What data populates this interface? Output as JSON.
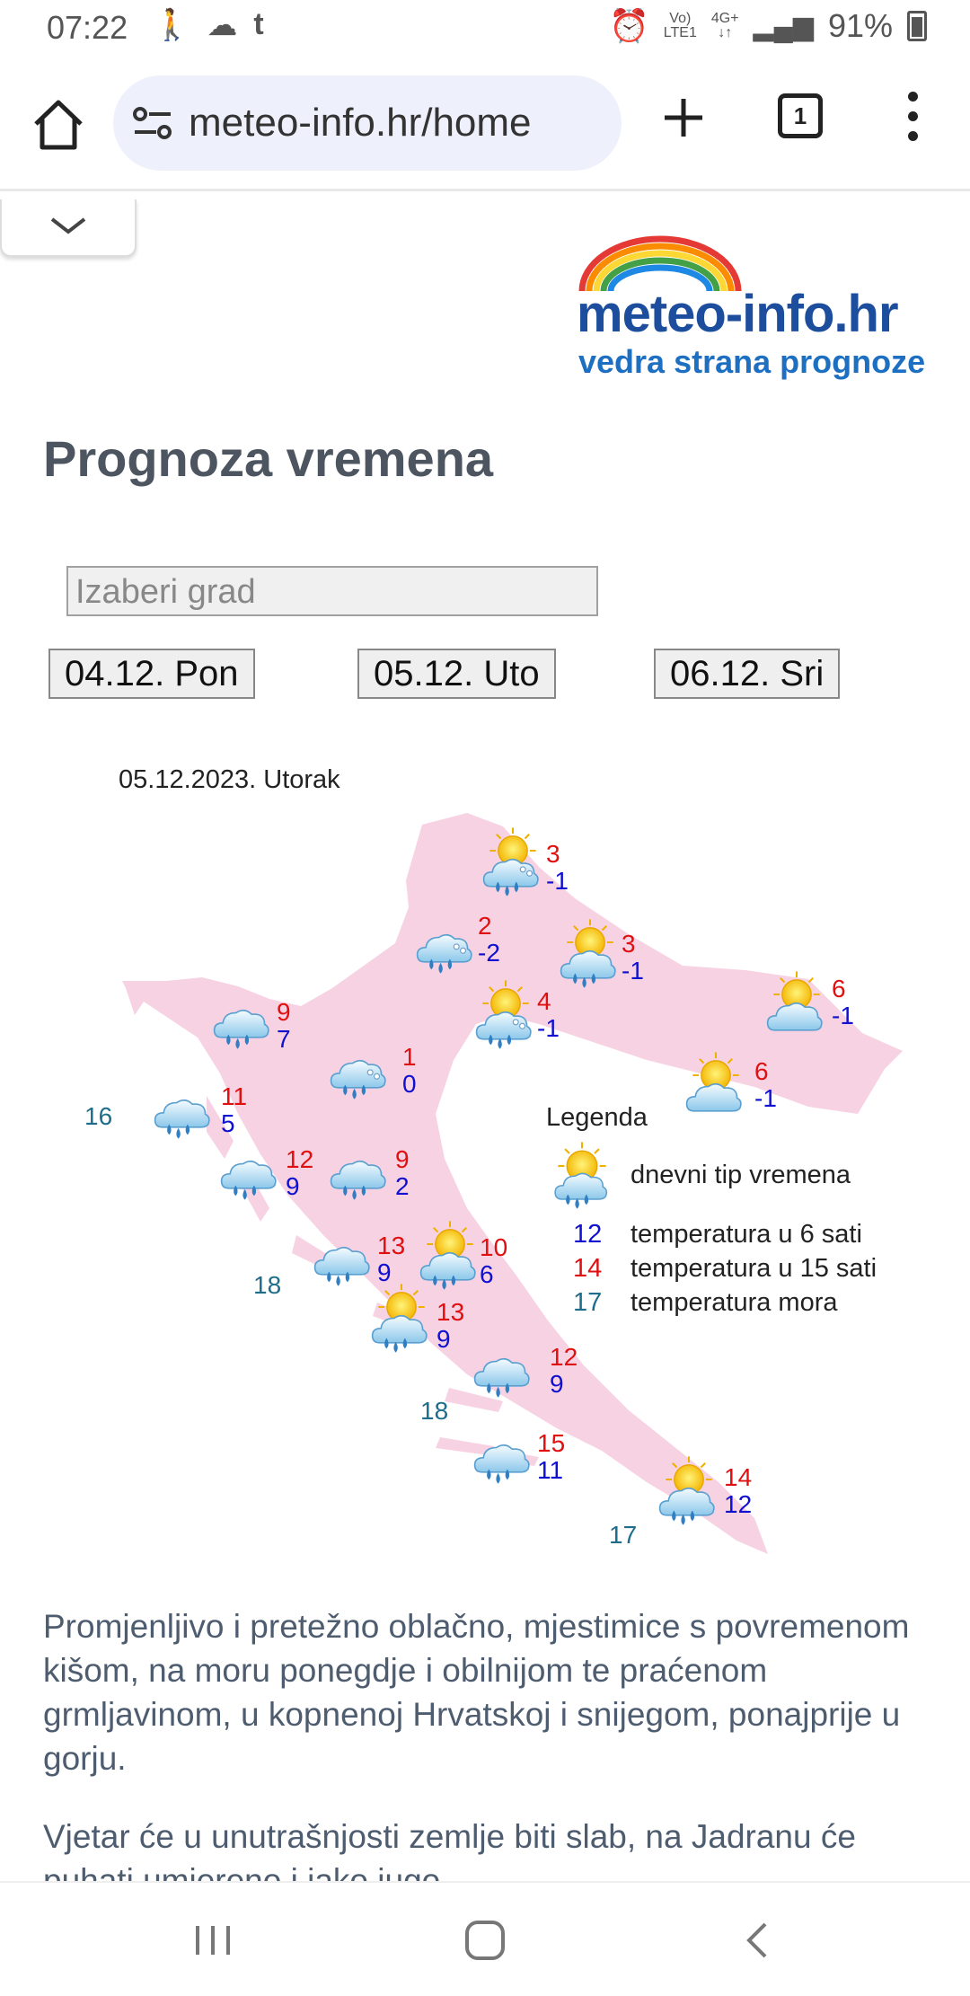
{
  "status_bar": {
    "time": "07:22",
    "left_icons": [
      "walking-icon",
      "cloud-icon",
      "tumblr-icon"
    ],
    "alarm_icon": "alarm-icon",
    "volte_top": "Vo)",
    "volte_bottom": "LTE1",
    "network": "4G+",
    "battery": "91%"
  },
  "browser": {
    "url": "meteo-info.hr/home",
    "tab_count": "1"
  },
  "logo": {
    "brand": "meteo-info.hr",
    "tagline": "vedra strana prognoze"
  },
  "page": {
    "title": "Prognoza vremena",
    "city_placeholder": "Izaberi grad",
    "days": [
      "04.12. Pon",
      "05.12. Uto",
      "06.12. Sri"
    ],
    "map_date": "05.12.2023. Utorak"
  },
  "map": {
    "stations": [
      {
        "icon": "sun-cloud-rain-snow-icon",
        "high": "3",
        "low": "-1"
      },
      {
        "icon": "cloud-rain-snow-icon",
        "high": "2",
        "low": "-2"
      },
      {
        "icon": "sun-cloud-rain-icon",
        "high": "3",
        "low": "-1"
      },
      {
        "icon": "sun-cloud-icon",
        "high": "6",
        "low": "-1"
      },
      {
        "icon": "sun-cloud-rain-snow-icon",
        "high": "4",
        "low": "-1"
      },
      {
        "icon": "cloud-rain-icon",
        "high": "9",
        "low": "7"
      },
      {
        "icon": "cloud-rain-snow-icon",
        "high": "1",
        "low": "0"
      },
      {
        "icon": "sun-cloud-icon",
        "high": "6",
        "low": "-1"
      },
      {
        "icon": "cloud-rain-icon",
        "high": "11",
        "low": "5"
      },
      {
        "icon": "cloud-rain-icon",
        "high": "12",
        "low": "9"
      },
      {
        "icon": "cloud-rain-icon",
        "high": "9",
        "low": "2"
      },
      {
        "icon": "cloud-rain-icon",
        "high": "13",
        "low": "9"
      },
      {
        "icon": "sun-cloud-rain-icon",
        "high": "10",
        "low": "6"
      },
      {
        "icon": "sun-cloud-rain-icon",
        "high": "13",
        "low": "9"
      },
      {
        "icon": "cloud-rain-icon",
        "high": "12",
        "low": "9"
      },
      {
        "icon": "cloud-rain-icon",
        "high": "15",
        "low": "11"
      },
      {
        "icon": "sun-cloud-rain-icon",
        "high": "14",
        "low": "12"
      }
    ],
    "sea_temps": [
      "16",
      "18",
      "18",
      "17"
    ]
  },
  "legend": {
    "title": "Legenda",
    "icon_label": "dnevni tip vremena",
    "rows": [
      {
        "num": "12",
        "label": "temperatura u 6 sati",
        "color": "#1010d0"
      },
      {
        "num": "14",
        "label": "temperatura u 15 sati",
        "color": "#e01010"
      },
      {
        "num": "17",
        "label": "temperatura mora",
        "color": "#1e6d8a"
      }
    ]
  },
  "description": {
    "p1": "Promjenljivo i pretežno oblačno, mjestimice s povremenom kišom, na moru ponegdje i obilnijom te praćenom grmljavinom, u kopnenoj Hrvatskoj i snijegom, ponajprije u gorju.",
    "p2": "Vjetar će u unutrašnjosti zemlje biti slab, na Jadranu će puhati umjereno i jako jugo."
  },
  "colors": {
    "map_fill": "#f7d2e2",
    "temp_high": "#e01010",
    "temp_low": "#1010d0",
    "sea": "#1e6d8a",
    "brand": "#1d4e9e"
  }
}
